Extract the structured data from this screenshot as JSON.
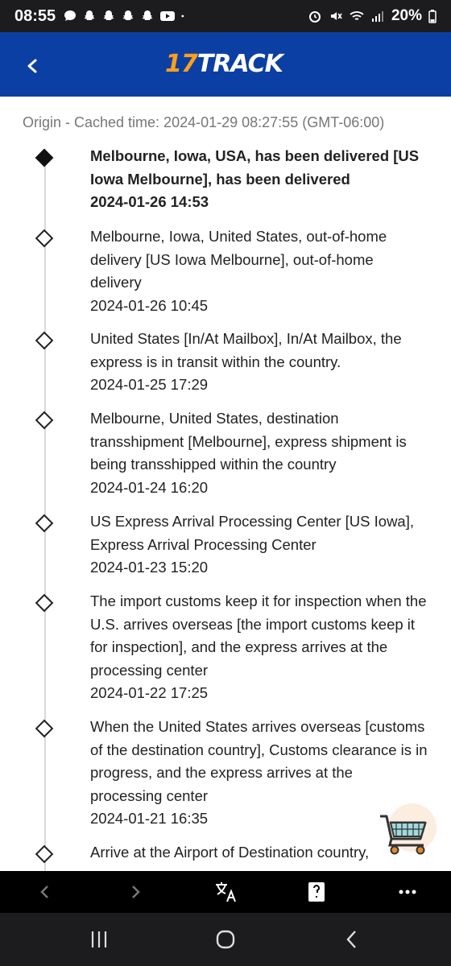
{
  "status_bar": {
    "time": "08:55",
    "battery": "20%"
  },
  "header": {
    "logo_number": "17",
    "logo_word": "TRACK"
  },
  "origin_text": "Origin - Cached time: 2024-01-29 08:27:55 (GMT-06:00)",
  "events": [
    {
      "description": "Melbourne, Iowa, USA, has been delivered [US Iowa Melbourne], has been delivered",
      "time": "2024-01-26 14:53"
    },
    {
      "description": "Melbourne, Iowa, United States, out-of-home delivery [US Iowa Melbourne], out-of-home delivery",
      "time": "2024-01-26 10:45"
    },
    {
      "description": "United States [In/At Mailbox], In/At Mailbox, the express is in transit within the country.",
      "time": "2024-01-25 17:29"
    },
    {
      "description": "Melbourne, United States, destination transshipment [Melbourne], express shipment is being transshipped within the country",
      "time": "2024-01-24 16:20"
    },
    {
      "description": "US Express Arrival Processing Center [US Iowa], Express Arrival Processing Center",
      "time": "2024-01-23 15:20"
    },
    {
      "description": "The import customs keep it for inspection when the U.S. arrives overseas [the import customs keep it for inspection], and the express arrives at the processing center",
      "time": "2024-01-22 17:25"
    },
    {
      "description": "When the United States arrives overseas [customs of the destination country], Customs clearance is in progress, and the express arrives at the processing center",
      "time": "2024-01-21 16:35"
    },
    {
      "description": "Arrive at the Airport of Destination country,",
      "time": ""
    }
  ],
  "icons": {
    "back": "chevron-left-icon",
    "translate": "translate-icon",
    "cart": "shopping-cart-icon"
  },
  "colors": {
    "header_bg": "#0c3fa3",
    "logo_accent": "#ff9f1a"
  }
}
